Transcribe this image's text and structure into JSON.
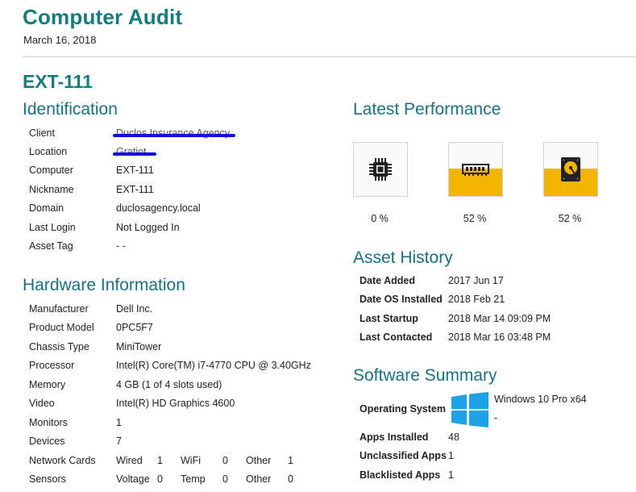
{
  "header": {
    "title": "Computer Audit",
    "date": "March 16, 2018"
  },
  "computer_name": "EXT-111",
  "identification": {
    "heading": "Identification",
    "rows": [
      {
        "label": "Client",
        "value": "Duclos Insurance Agency"
      },
      {
        "label": "Location",
        "value": "Gratiot"
      },
      {
        "label": "Computer",
        "value": "EXT-111"
      },
      {
        "label": "Nickname",
        "value": "EXT-111"
      },
      {
        "label": "Domain",
        "value": "duclosagency.local"
      },
      {
        "label": "Last Login",
        "value": "Not Logged In"
      },
      {
        "label": "Asset Tag",
        "value": "- -"
      }
    ]
  },
  "hardware": {
    "heading": "Hardware Information",
    "rows": [
      {
        "label": "Manufacturer",
        "value": "Dell Inc."
      },
      {
        "label": "Product Model",
        "value": "0PC5F7"
      },
      {
        "label": "Chassis Type",
        "value": "MiniTower"
      },
      {
        "label": "Processor",
        "value": "Intel(R) Core(TM) i7-4770 CPU @ 3.40GHz"
      },
      {
        "label": "Memory",
        "value": "4 GB (1 of 4 slots used)"
      },
      {
        "label": "Video",
        "value": "Intel(R) HD Graphics 4600"
      },
      {
        "label": "Monitors",
        "value": "1"
      },
      {
        "label": "Devices",
        "value": "7"
      }
    ],
    "network_cards": {
      "label": "Network Cards",
      "items": [
        {
          "name": "Wired",
          "value": "1"
        },
        {
          "name": "WiFi",
          "value": "0"
        },
        {
          "name": "Other",
          "value": "1"
        }
      ]
    },
    "sensors": {
      "label": "Sensors",
      "items": [
        {
          "name": "Voltage",
          "value": "0"
        },
        {
          "name": "Temp",
          "value": "0"
        },
        {
          "name": "Other",
          "value": "0"
        }
      ]
    }
  },
  "performance": {
    "heading": "Latest Performance",
    "items": [
      {
        "icon": "cpu-icon",
        "value": "0 %",
        "fill": 0.0
      },
      {
        "icon": "memory-icon",
        "value": "52 %",
        "fill": 0.52
      },
      {
        "icon": "disk-icon",
        "value": "52 %",
        "fill": 0.52
      }
    ],
    "fill_color": "#f4b500"
  },
  "asset_history": {
    "heading": "Asset History",
    "rows": [
      {
        "label": "Date Added",
        "value": "2017 Jun 17"
      },
      {
        "label": "Date OS Installed",
        "value": "2018 Feb 21"
      },
      {
        "label": "Last Startup",
        "value": "2018 Mar 14 09:09 PM"
      },
      {
        "label": "Last Contacted",
        "value": "2018 Mar 16 03:48 PM"
      }
    ]
  },
  "software": {
    "heading": "Software Summary",
    "os_label": "Operating System",
    "os_value": "Windows 10 Pro x64",
    "os_sub": "-",
    "rows": [
      {
        "label": "Apps Installed",
        "value": "48"
      },
      {
        "label": "Unclassified Apps",
        "value": "1"
      },
      {
        "label": "Blacklisted Apps",
        "value": "1"
      }
    ]
  },
  "colors": {
    "accent": "#147b80",
    "heading": "#1a6f86",
    "redaction": "#1010d8",
    "windows_blue": "#1ea1e6"
  }
}
